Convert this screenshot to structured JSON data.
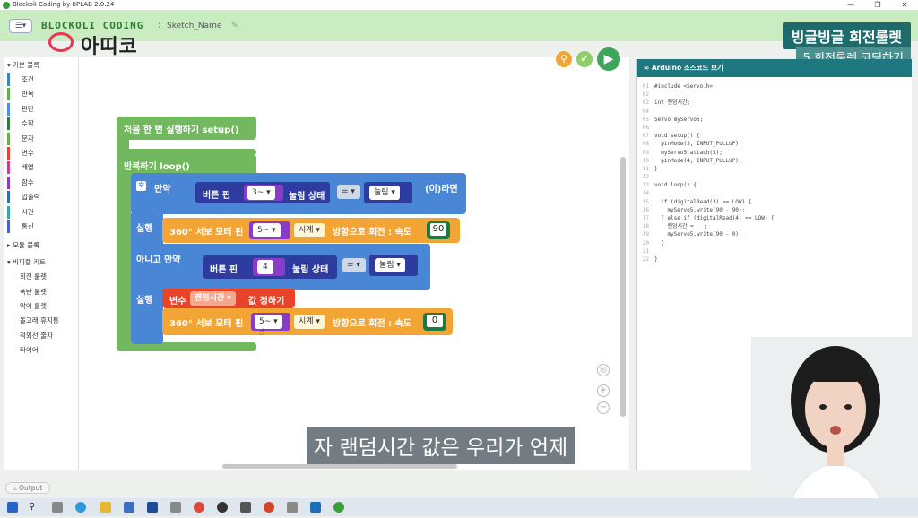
{
  "window": {
    "title": "Blockoli Coding by 8PLAB 2.0.24"
  },
  "header": {
    "brand": "BLOCKOLI CODING",
    "separator": ":",
    "sketch_name": "Sketch_Name",
    "logo_text": "아띠코"
  },
  "overlay": {
    "title": "빙글빙글 회전룰렛",
    "subtitle": "5.회전룰렛 코딩하기"
  },
  "palette": {
    "basic_header": "▾ 기본 블록",
    "basic": [
      {
        "label": "조건",
        "color": "#3b82d6"
      },
      {
        "label": "반복",
        "color": "#5fb048"
      },
      {
        "label": "판단",
        "color": "#4d8de0"
      },
      {
        "label": "수학",
        "color": "#2f7d3a"
      },
      {
        "label": "문자",
        "color": "#6cae4a"
      },
      {
        "label": "변수",
        "color": "#e8442a"
      },
      {
        "label": "배열",
        "color": "#d83a8a"
      },
      {
        "label": "함수",
        "color": "#8a3bc9"
      },
      {
        "label": "입출력",
        "color": "#2d6fb0"
      },
      {
        "label": "시간",
        "color": "#3aa3b0"
      },
      {
        "label": "통신",
        "color": "#4a5fd0"
      }
    ],
    "module_header": "▸ 모듈 블록",
    "kit_header": "▾ 비피렙 키트",
    "kit": [
      "회전 룰렛",
      "폭탄 룰렛",
      "악어 룰렛",
      "돌고래 휴지통",
      "적외선 줄자",
      "타이어"
    ]
  },
  "blocks": {
    "setup": "처음 한 번 실행하기 setup()",
    "loop": "반복하기 loop()",
    "if": "만약",
    "button_pin": "버튼 핀",
    "pin_3": "3~",
    "press_state": "눌림 상태",
    "eq": "=",
    "pressed": "눌림",
    "then": "(이)라면",
    "do": "실행",
    "servo_360": "360° 서보 모터 핀",
    "pin_5": "5~",
    "clockwise": "시계",
    "rotate_speed": "방향으로 회전 : 속도",
    "speed_90": "90",
    "else_if": "아니고 만약",
    "pin_4": "4",
    "var": "변수",
    "var_name": "랜덤시간",
    "set_value": "값 정하기",
    "speed_0": "0"
  },
  "code": {
    "title": "Arduino 소스코드 보기",
    "lines": [
      {
        "n": "01",
        "t": "#include <Servo.h>"
      },
      {
        "n": "02",
        "t": ""
      },
      {
        "n": "03",
        "t": "int 랜덤시간;"
      },
      {
        "n": "04",
        "t": ""
      },
      {
        "n": "05",
        "t": "Servo myServo5;"
      },
      {
        "n": "06",
        "t": ""
      },
      {
        "n": "07",
        "t": "void setup() {"
      },
      {
        "n": "08",
        "t": "  pinMode(3, INPUT_PULLUP);"
      },
      {
        "n": "09",
        "t": "  myServo5.attach(5);"
      },
      {
        "n": "10",
        "t": "  pinMode(4, INPUT_PULLUP);"
      },
      {
        "n": "11",
        "t": "}"
      },
      {
        "n": "12",
        "t": ""
      },
      {
        "n": "13",
        "t": "void loop() {"
      },
      {
        "n": "14",
        "t": ""
      },
      {
        "n": "15",
        "t": "  if (digitalRead(3) == LOW) {"
      },
      {
        "n": "16",
        "t": "    myServo5.write(90 - 90);"
      },
      {
        "n": "17",
        "t": "  } else if (digitalRead(4) == LOW) {"
      },
      {
        "n": "18",
        "t": "    랜덤시간 = __;"
      },
      {
        "n": "19",
        "t": "    myServo5.write(90 - 0);"
      },
      {
        "n": "20",
        "t": "  }"
      },
      {
        "n": "21",
        "t": ""
      },
      {
        "n": "22",
        "t": "}"
      }
    ]
  },
  "output_label": "Output",
  "subtitle": "자 랜덤시간 값은 우리가 언제"
}
